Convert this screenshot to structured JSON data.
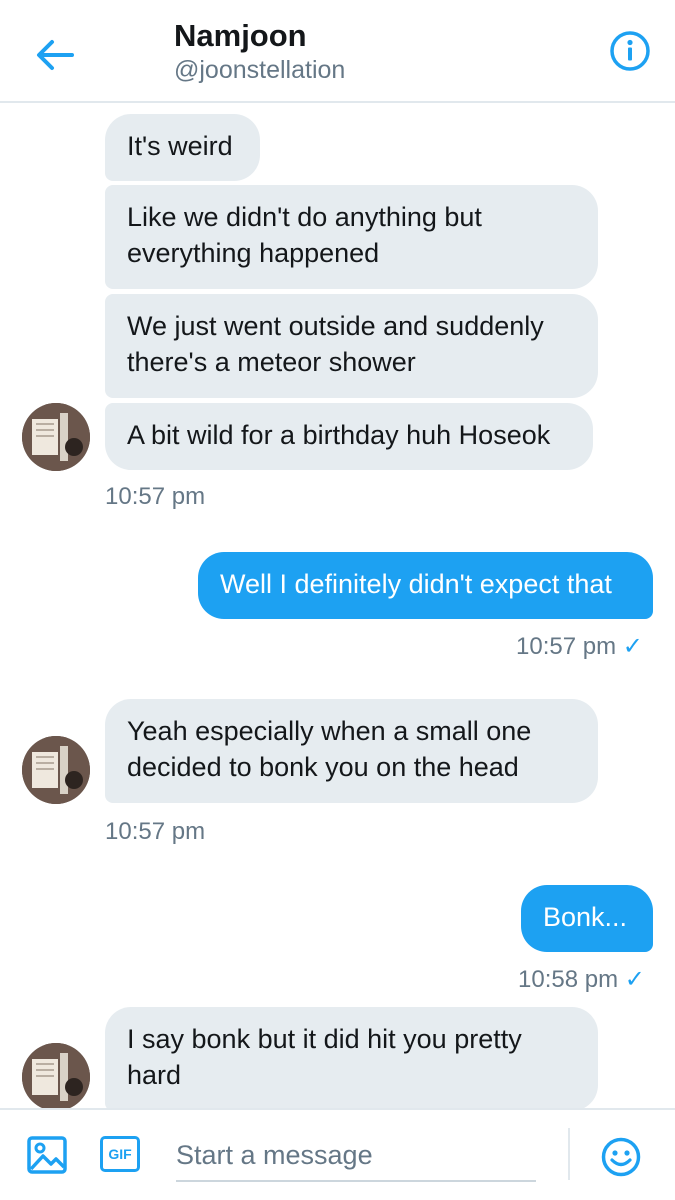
{
  "header": {
    "name": "Namjoon",
    "handle": "@joonstellation",
    "back_icon": "arrow-left-icon",
    "info_icon": "info-icon"
  },
  "messages": [
    {
      "side": "in",
      "text": "It's weird"
    },
    {
      "side": "in",
      "text": "Like we didn't do anything but\neverything happened"
    },
    {
      "side": "in",
      "text": "We just went outside and suddenly\nthere's a meteor shower"
    },
    {
      "side": "in",
      "text": "A bit wild for a birthday huh Hoseok"
    },
    {
      "side": "out",
      "text": "Well I definitely didn't expect that"
    },
    {
      "side": "in",
      "text": "Yeah especially when a small one\ndecided to bonk you on the head"
    },
    {
      "side": "out",
      "text": "Bonk..."
    },
    {
      "side": "in",
      "text": "I say bonk but it did hit you pretty\nhard"
    }
  ],
  "timestamps": {
    "t1": "10:57 pm",
    "t2": "10:57 pm",
    "t3": "10:57 pm",
    "t4": "10:58 pm",
    "check": "✓"
  },
  "composer": {
    "placeholder": "Start a message",
    "gif_label": "GIF",
    "media_icon": "image-icon",
    "emoji_icon": "emoji-icon"
  },
  "colors": {
    "accent": "#1da1f2",
    "incoming_bubble": "#e6ecf0",
    "secondary_text": "#657786"
  }
}
